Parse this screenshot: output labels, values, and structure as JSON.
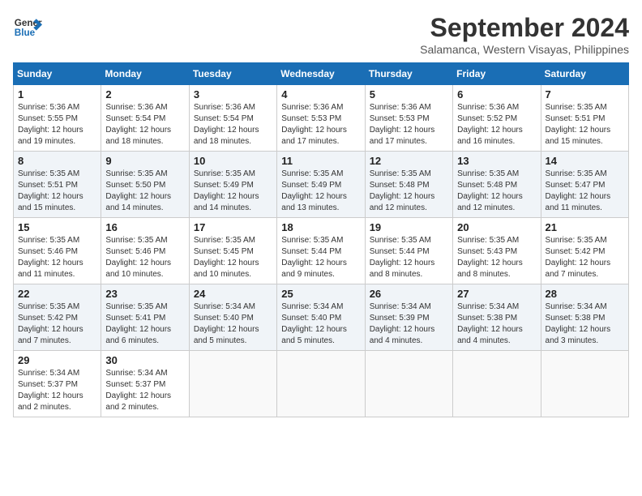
{
  "header": {
    "logo_line1": "General",
    "logo_line2": "Blue",
    "month": "September 2024",
    "location": "Salamanca, Western Visayas, Philippines"
  },
  "weekdays": [
    "Sunday",
    "Monday",
    "Tuesday",
    "Wednesday",
    "Thursday",
    "Friday",
    "Saturday"
  ],
  "weeks": [
    [
      {
        "day": "1",
        "info": "Sunrise: 5:36 AM\nSunset: 5:55 PM\nDaylight: 12 hours\nand 19 minutes."
      },
      {
        "day": "2",
        "info": "Sunrise: 5:36 AM\nSunset: 5:54 PM\nDaylight: 12 hours\nand 18 minutes."
      },
      {
        "day": "3",
        "info": "Sunrise: 5:36 AM\nSunset: 5:54 PM\nDaylight: 12 hours\nand 18 minutes."
      },
      {
        "day": "4",
        "info": "Sunrise: 5:36 AM\nSunset: 5:53 PM\nDaylight: 12 hours\nand 17 minutes."
      },
      {
        "day": "5",
        "info": "Sunrise: 5:36 AM\nSunset: 5:53 PM\nDaylight: 12 hours\nand 17 minutes."
      },
      {
        "day": "6",
        "info": "Sunrise: 5:36 AM\nSunset: 5:52 PM\nDaylight: 12 hours\nand 16 minutes."
      },
      {
        "day": "7",
        "info": "Sunrise: 5:35 AM\nSunset: 5:51 PM\nDaylight: 12 hours\nand 15 minutes."
      }
    ],
    [
      {
        "day": "8",
        "info": "Sunrise: 5:35 AM\nSunset: 5:51 PM\nDaylight: 12 hours\nand 15 minutes."
      },
      {
        "day": "9",
        "info": "Sunrise: 5:35 AM\nSunset: 5:50 PM\nDaylight: 12 hours\nand 14 minutes."
      },
      {
        "day": "10",
        "info": "Sunrise: 5:35 AM\nSunset: 5:49 PM\nDaylight: 12 hours\nand 14 minutes."
      },
      {
        "day": "11",
        "info": "Sunrise: 5:35 AM\nSunset: 5:49 PM\nDaylight: 12 hours\nand 13 minutes."
      },
      {
        "day": "12",
        "info": "Sunrise: 5:35 AM\nSunset: 5:48 PM\nDaylight: 12 hours\nand 12 minutes."
      },
      {
        "day": "13",
        "info": "Sunrise: 5:35 AM\nSunset: 5:48 PM\nDaylight: 12 hours\nand 12 minutes."
      },
      {
        "day": "14",
        "info": "Sunrise: 5:35 AM\nSunset: 5:47 PM\nDaylight: 12 hours\nand 11 minutes."
      }
    ],
    [
      {
        "day": "15",
        "info": "Sunrise: 5:35 AM\nSunset: 5:46 PM\nDaylight: 12 hours\nand 11 minutes."
      },
      {
        "day": "16",
        "info": "Sunrise: 5:35 AM\nSunset: 5:46 PM\nDaylight: 12 hours\nand 10 minutes."
      },
      {
        "day": "17",
        "info": "Sunrise: 5:35 AM\nSunset: 5:45 PM\nDaylight: 12 hours\nand 10 minutes."
      },
      {
        "day": "18",
        "info": "Sunrise: 5:35 AM\nSunset: 5:44 PM\nDaylight: 12 hours\nand 9 minutes."
      },
      {
        "day": "19",
        "info": "Sunrise: 5:35 AM\nSunset: 5:44 PM\nDaylight: 12 hours\nand 8 minutes."
      },
      {
        "day": "20",
        "info": "Sunrise: 5:35 AM\nSunset: 5:43 PM\nDaylight: 12 hours\nand 8 minutes."
      },
      {
        "day": "21",
        "info": "Sunrise: 5:35 AM\nSunset: 5:42 PM\nDaylight: 12 hours\nand 7 minutes."
      }
    ],
    [
      {
        "day": "22",
        "info": "Sunrise: 5:35 AM\nSunset: 5:42 PM\nDaylight: 12 hours\nand 7 minutes."
      },
      {
        "day": "23",
        "info": "Sunrise: 5:35 AM\nSunset: 5:41 PM\nDaylight: 12 hours\nand 6 minutes."
      },
      {
        "day": "24",
        "info": "Sunrise: 5:34 AM\nSunset: 5:40 PM\nDaylight: 12 hours\nand 5 minutes."
      },
      {
        "day": "25",
        "info": "Sunrise: 5:34 AM\nSunset: 5:40 PM\nDaylight: 12 hours\nand 5 minutes."
      },
      {
        "day": "26",
        "info": "Sunrise: 5:34 AM\nSunset: 5:39 PM\nDaylight: 12 hours\nand 4 minutes."
      },
      {
        "day": "27",
        "info": "Sunrise: 5:34 AM\nSunset: 5:38 PM\nDaylight: 12 hours\nand 4 minutes."
      },
      {
        "day": "28",
        "info": "Sunrise: 5:34 AM\nSunset: 5:38 PM\nDaylight: 12 hours\nand 3 minutes."
      }
    ],
    [
      {
        "day": "29",
        "info": "Sunrise: 5:34 AM\nSunset: 5:37 PM\nDaylight: 12 hours\nand 2 minutes."
      },
      {
        "day": "30",
        "info": "Sunrise: 5:34 AM\nSunset: 5:37 PM\nDaylight: 12 hours\nand 2 minutes."
      },
      {
        "day": "",
        "info": ""
      },
      {
        "day": "",
        "info": ""
      },
      {
        "day": "",
        "info": ""
      },
      {
        "day": "",
        "info": ""
      },
      {
        "day": "",
        "info": ""
      }
    ]
  ]
}
